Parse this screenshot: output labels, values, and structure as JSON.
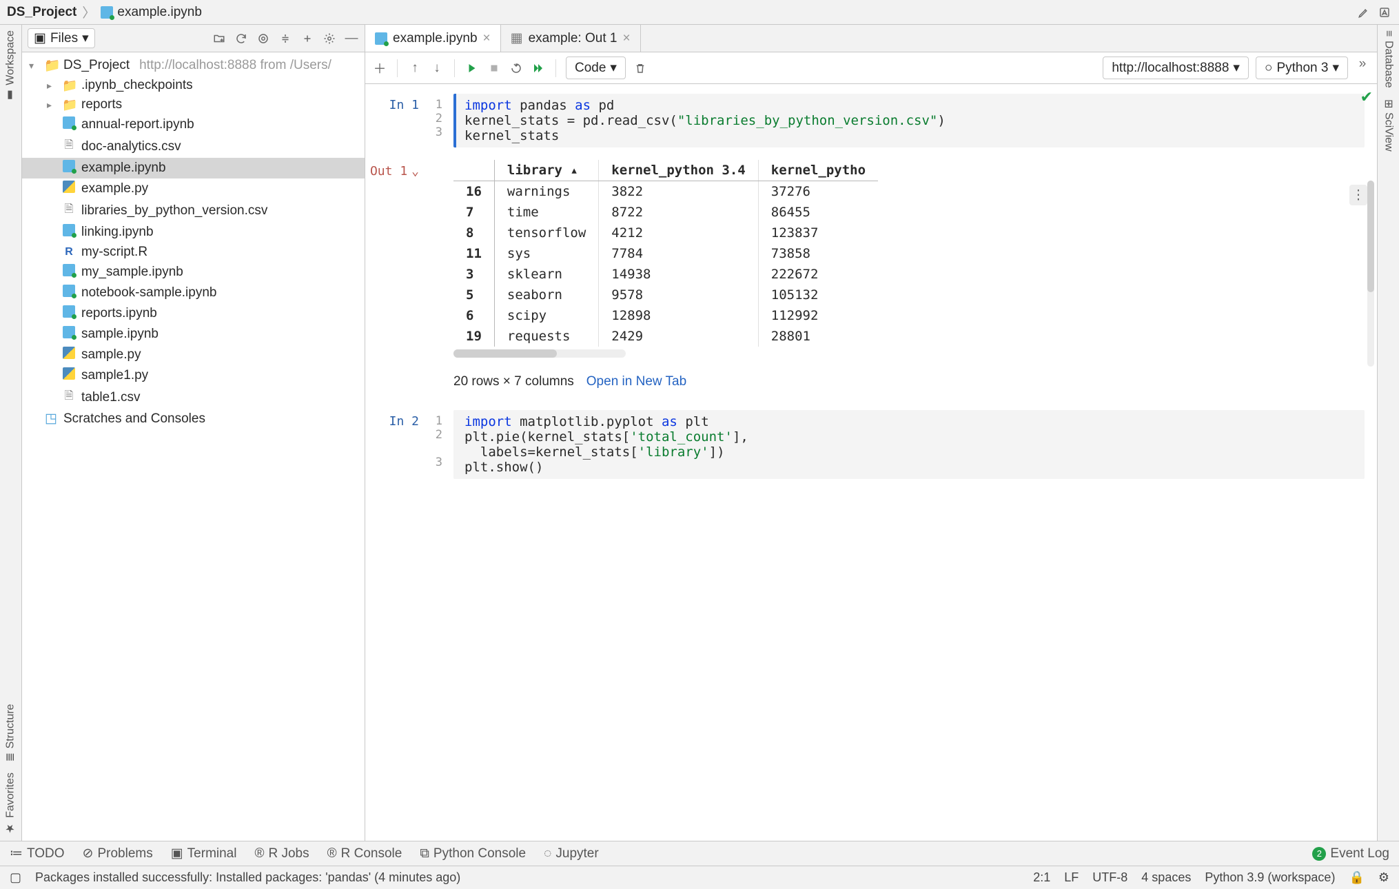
{
  "breadcrumb": {
    "project": "DS_Project",
    "file": "example.ipynb"
  },
  "sidebars": {
    "left": {
      "top": "Workspace",
      "structure": "Structure",
      "favorites": "Favorites"
    },
    "right": {
      "database": "Database",
      "sciview": "SciView"
    }
  },
  "project_panel": {
    "title": "Files",
    "root": {
      "name": "DS_Project",
      "subtitle": "http://localhost:8888 from /Users/"
    },
    "items": [
      {
        "depth": 1,
        "type": "folder",
        "arrow": "▸",
        "name": ".ipynb_checkpoints"
      },
      {
        "depth": 1,
        "type": "folder",
        "arrow": "▸",
        "name": "reports"
      },
      {
        "depth": 1,
        "type": "ipynb",
        "name": "annual-report.ipynb"
      },
      {
        "depth": 1,
        "type": "csv",
        "name": "doc-analytics.csv"
      },
      {
        "depth": 1,
        "type": "ipynb",
        "name": "example.ipynb",
        "selected": true
      },
      {
        "depth": 1,
        "type": "py",
        "name": "example.py"
      },
      {
        "depth": 1,
        "type": "csv",
        "name": "libraries_by_python_version.csv"
      },
      {
        "depth": 1,
        "type": "ipynb",
        "name": "linking.ipynb"
      },
      {
        "depth": 1,
        "type": "r",
        "name": "my-script.R"
      },
      {
        "depth": 1,
        "type": "ipynb",
        "name": "my_sample.ipynb"
      },
      {
        "depth": 1,
        "type": "ipynb",
        "name": "notebook-sample.ipynb"
      },
      {
        "depth": 1,
        "type": "ipynb",
        "name": "reports.ipynb"
      },
      {
        "depth": 1,
        "type": "ipynb",
        "name": "sample.ipynb"
      },
      {
        "depth": 1,
        "type": "py",
        "name": "sample.py"
      },
      {
        "depth": 1,
        "type": "py",
        "name": "sample1.py"
      },
      {
        "depth": 1,
        "type": "csv",
        "name": "table1.csv"
      }
    ],
    "scratches": "Scratches and Consoles"
  },
  "tabs": [
    {
      "icon": "ipynb",
      "label": "example.ipynb",
      "active": true,
      "closeable": true
    },
    {
      "icon": "table",
      "label": "example: Out 1",
      "active": false,
      "closeable": true
    }
  ],
  "notebook_toolbar": {
    "celltype": "Code",
    "server": "http://localhost:8888",
    "kernel": "Python 3"
  },
  "cells": {
    "in1": {
      "prompt": "In 1",
      "lines": [
        "1",
        "2",
        "3"
      ],
      "code_html": "<span class='c-kw'>import</span> pandas <span class='c-kw'>as</span> pd\nkernel_stats = pd.read_csv(<span class='c-str'>\"libraries_by_python_version.csv\"</span>)\nkernel_stats"
    },
    "out1": {
      "prompt": "Out 1",
      "columns": [
        "",
        "library  ▴",
        "kernel_python 3.4",
        "kernel_pytho"
      ],
      "rows": [
        [
          "16",
          "warnings",
          "3822",
          "37276"
        ],
        [
          "7",
          "time",
          "8722",
          "86455"
        ],
        [
          "8",
          "tensorflow",
          "4212",
          "123837"
        ],
        [
          "11",
          "sys",
          "7784",
          "73858"
        ],
        [
          "3",
          "sklearn",
          "14938",
          "222672"
        ],
        [
          "5",
          "seaborn",
          "9578",
          "105132"
        ],
        [
          "6",
          "scipy",
          "12898",
          "112992"
        ],
        [
          "19",
          "requests",
          "2429",
          "28801"
        ]
      ],
      "shape_text": "20 rows × 7 columns",
      "open_link": "Open in New Tab"
    },
    "in2": {
      "prompt": "In 2",
      "lines": [
        "1",
        "2",
        "",
        "3"
      ],
      "code_html": "<span class='c-kw'>import</span> matplotlib.pyplot <span class='c-kw'>as</span> plt\nplt.pie(kernel_stats[<span class='c-str'>'total_count'</span>],\n  labels=kernel_stats[<span class='c-str'>'library'</span>])\nplt.show()"
    }
  },
  "tool_windows": [
    "TODO",
    "Problems",
    "Terminal",
    "R Jobs",
    "R Console",
    "Python Console",
    "Jupyter"
  ],
  "event_log": {
    "badge": "2",
    "label": "Event Log"
  },
  "status": {
    "message": "Packages installed successfully: Installed packages: 'pandas' (4 minutes ago)",
    "caret": "2:1",
    "sep": "LF",
    "enc": "UTF-8",
    "indent": "4 spaces",
    "interp": "Python 3.9 (workspace)"
  }
}
